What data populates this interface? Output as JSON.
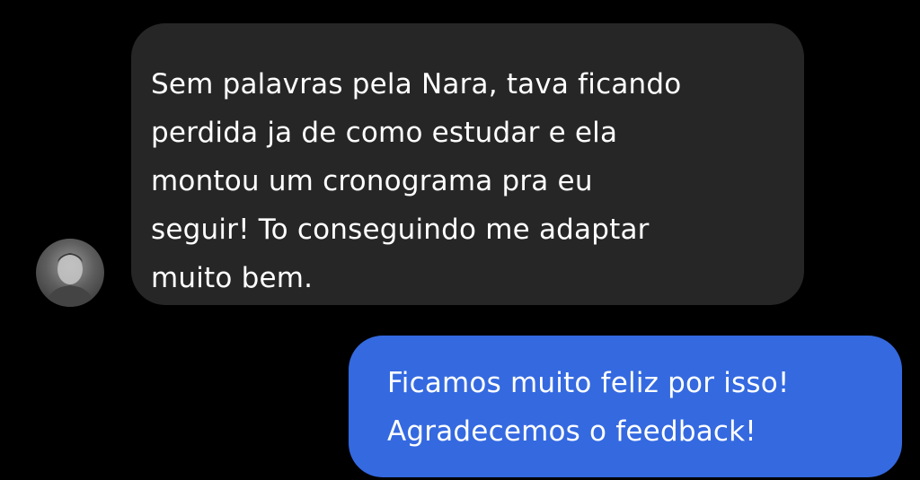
{
  "conversation": {
    "messages": [
      {
        "direction": "incoming",
        "text": "Sem palavras pela Nara, tava ficando\nperdida ja de como estudar e ela\nmontou um cronograma pra eu\nseguir! To conseguindo me adaptar\nmuito bem."
      },
      {
        "direction": "outgoing",
        "text": "Ficamos muito feliz por isso!\nAgradecemos o feedback!"
      }
    ]
  },
  "colors": {
    "background": "#000000",
    "incoming_bubble": "#262626",
    "outgoing_bubble": "#3469e0",
    "text": "#ffffff"
  },
  "icons": {
    "sender_avatar": "avatar-photo"
  }
}
